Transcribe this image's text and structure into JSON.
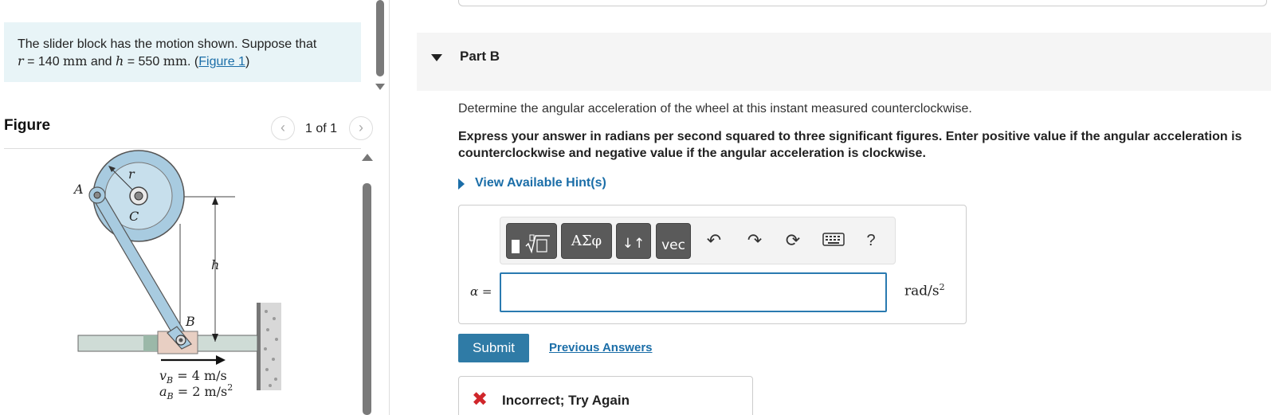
{
  "problem": {
    "text_before": "The slider block has the motion shown. Suppose that",
    "r_var": "r",
    "r_eq": " = ",
    "r_value": "140",
    "r_unit": "mm",
    "and": " and ",
    "h_var": "h",
    "h_eq": " = ",
    "h_value": "550",
    "h_unit": "mm",
    "period": ". (",
    "figure_link": "Figure 1",
    "close": ")"
  },
  "figure": {
    "title": "Figure",
    "pager": "1 of 1",
    "labels": {
      "A": "A",
      "C": "C",
      "r": "r",
      "h": "h",
      "B": "B",
      "vB": "v",
      "vB_sub": "B",
      "vB_value": " = 4 m/s",
      "aB": "a",
      "aB_sub": "B",
      "aB_value": " = 2 m/s",
      "aB_exp": "2"
    }
  },
  "part": {
    "title": "Part B",
    "question": "Determine the angular acceleration of the wheel at this instant measured counterclockwise.",
    "instructions": "Express your answer in radians per second squared to three significant figures. Enter positive value if the angular acceleration is counterclockwise and negative value if the angular acceleration is clockwise.",
    "hint_link": "View Available Hint(s)"
  },
  "toolbar": {
    "greek": "ΑΣφ",
    "arrows": "↓↑",
    "vec": "vec",
    "help": "?"
  },
  "answer": {
    "variable": "α",
    "equals": " =",
    "value": "",
    "units_base": "rad/s",
    "units_exp": "2"
  },
  "actions": {
    "submit": "Submit",
    "previous_answers": "Previous Answers"
  },
  "feedback": {
    "icon": "✖",
    "text": "Incorrect; Try Again"
  }
}
